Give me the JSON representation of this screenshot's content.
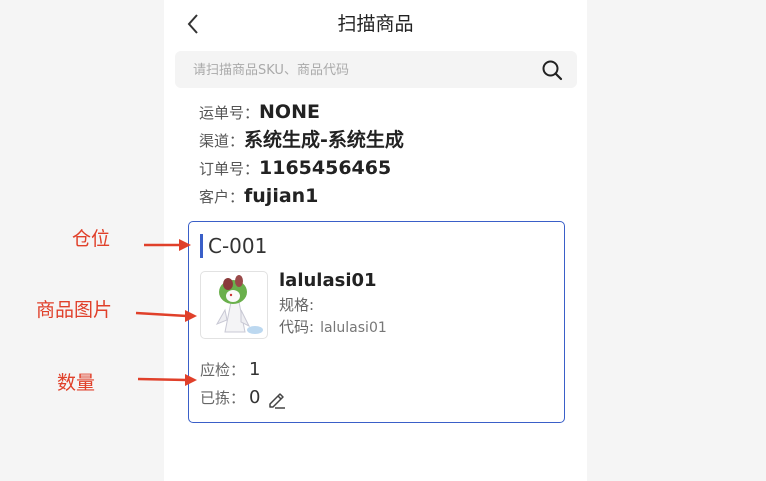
{
  "header": {
    "title": "扫描商品"
  },
  "search": {
    "placeholder": "请扫描商品SKU、商品代码"
  },
  "info": {
    "waybill_label": "运单号：",
    "waybill_value": "NONE",
    "channel_label": "渠道：",
    "channel_value": "系统生成-系统生成",
    "order_label": "订单号：",
    "order_value": "1165456465",
    "customer_label": "客户：",
    "customer_value": "fujian1"
  },
  "card": {
    "location": "C-001",
    "product_name": "lalulasi01",
    "spec_label": "规格:",
    "spec_value": "",
    "code_label": "代码:",
    "code_value": "lalulasi01",
    "expected_label": "应检：",
    "expected_value": "1",
    "picked_label": "已拣：",
    "picked_value": "0"
  },
  "annotations": {
    "location": "仓位",
    "image": "商品图片",
    "quantity": "数量"
  },
  "colors": {
    "accent": "#3a5fc8",
    "annotation": "#e0402a"
  }
}
